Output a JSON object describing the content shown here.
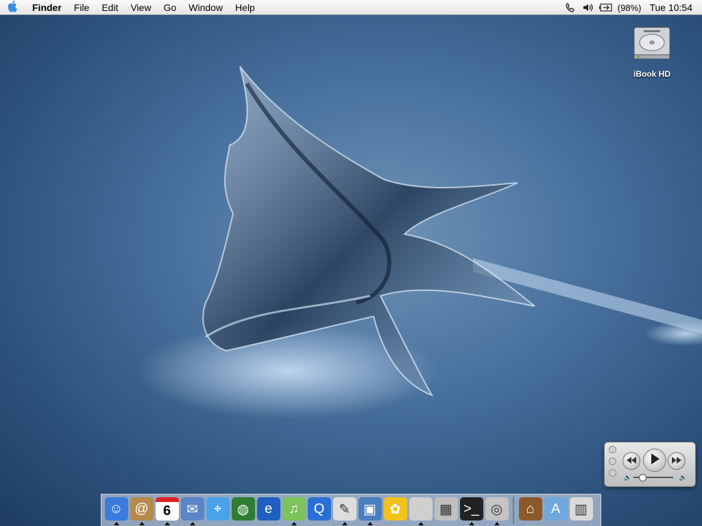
{
  "menubar": {
    "apple_icon": "apple-icon",
    "app_name": "Finder",
    "items": [
      "File",
      "Edit",
      "View",
      "Go",
      "Window",
      "Help"
    ],
    "status": {
      "phone_icon": "phone-icon",
      "volume_icon": "speaker-icon",
      "battery_icon": "battery-icon",
      "battery_text": "(98%)",
      "clock": "Tue 10:54"
    }
  },
  "desktop": {
    "icons": [
      {
        "label": "iBook HD",
        "icon": "hard-drive-icon"
      }
    ]
  },
  "controller": {
    "buttons": [
      "rewind-icon",
      "play-icon",
      "fast-forward-icon"
    ],
    "volume_level": 0.2
  },
  "dock": {
    "apps": [
      {
        "name": "finder-icon",
        "color": "#3b7be0",
        "running": true
      },
      {
        "name": "address-book-icon",
        "color": "#b58a4a",
        "running": true
      },
      {
        "name": "ical-icon",
        "color": "#ffffff",
        "running": true,
        "text": "6"
      },
      {
        "name": "mail-icon",
        "color": "#5a86c7",
        "running": true
      },
      {
        "name": "safari-icon",
        "color": "#4aa3e8",
        "running": false
      },
      {
        "name": "globe-icon",
        "color": "#2e7d32",
        "running": false
      },
      {
        "name": "internet-explorer-icon",
        "color": "#1f5fbf",
        "running": false
      },
      {
        "name": "itunes-icon",
        "color": "#7cc35b",
        "running": true
      },
      {
        "name": "quicktime-icon",
        "color": "#2a6fd3",
        "running": false
      },
      {
        "name": "textedit-icon",
        "color": "#dddddd",
        "running": true
      },
      {
        "name": "preview-icon",
        "color": "#4a7fbf",
        "running": true
      },
      {
        "name": "sunflower-icon",
        "color": "#f2c21c",
        "running": false
      },
      {
        "name": "system-info-icon",
        "color": "#cfcfcf",
        "running": true
      },
      {
        "name": "calculator-icon",
        "color": "#bfbfbf",
        "running": false
      },
      {
        "name": "terminal-icon",
        "color": "#222222",
        "running": true
      },
      {
        "name": "color-picker-icon",
        "color": "#c4c4c4",
        "running": true
      }
    ],
    "right": [
      {
        "name": "home-folder-icon",
        "color": "#8a5a2a",
        "running": false
      },
      {
        "name": "applications-folder-icon",
        "color": "#6fa8dc",
        "running": false
      },
      {
        "name": "trash-icon",
        "color": "#d9d9d9",
        "running": false
      }
    ]
  }
}
